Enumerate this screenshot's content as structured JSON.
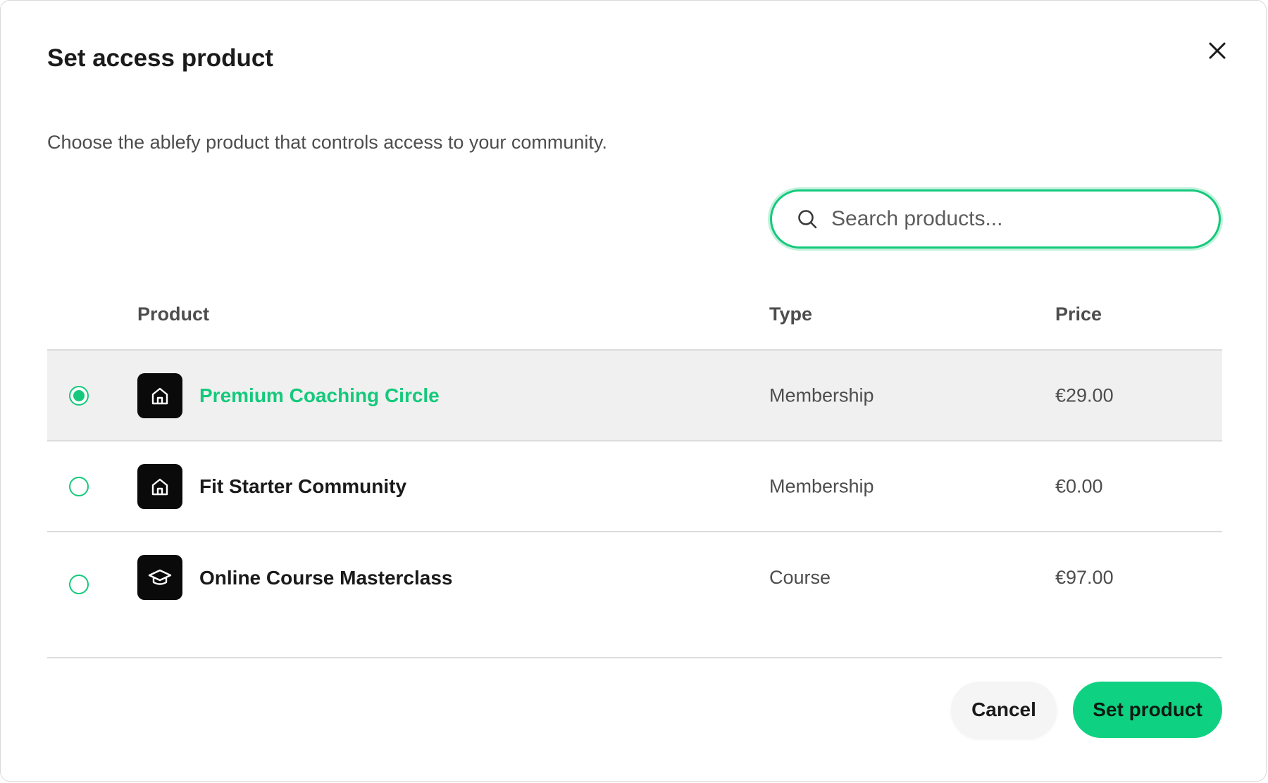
{
  "dialog": {
    "title": "Set access product",
    "subtitle": "Choose the ablefy product that controls access to your community.",
    "close_icon": "close-icon"
  },
  "search": {
    "placeholder": "Search products...",
    "value": "",
    "icon": "search-icon"
  },
  "table": {
    "columns": {
      "product": "Product",
      "type": "Type",
      "price": "Price"
    },
    "rows": [
      {
        "name": "Premium Coaching Circle",
        "type": "Membership",
        "price": "€29.00",
        "icon": "home-icon",
        "selected": true
      },
      {
        "name": "Fit Starter Community",
        "type": "Membership",
        "price": "€0.00",
        "icon": "home-icon",
        "selected": false
      },
      {
        "name": "Online Course Masterclass",
        "type": "Course",
        "price": "€97.00",
        "icon": "graduation-cap-icon",
        "selected": false
      }
    ]
  },
  "footer": {
    "cancel_label": "Cancel",
    "submit_label": "Set product"
  },
  "colors": {
    "accent": "#15c97c",
    "primary_button": "#0ed282",
    "selected_row_bg": "#f0f0f0"
  }
}
